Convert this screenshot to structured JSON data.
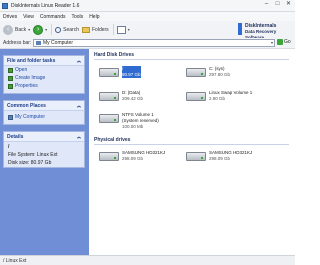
{
  "window": {
    "title": "DiskInternals Linux Reader 1.6"
  },
  "menu": [
    "Drives",
    "View",
    "Commands",
    "Tools",
    "Help"
  ],
  "toolbar": {
    "back": "Back",
    "search": "Search",
    "folders": "Folders"
  },
  "address": {
    "label": "Address bar:",
    "value": "My Computer",
    "go": "Go"
  },
  "brand": {
    "name": "DiskInternals",
    "tagline": "Data Recovery Software"
  },
  "sidebar": {
    "tasks_title": "File and folder tasks",
    "tasks": [
      "Open",
      "Create Image",
      "Properties"
    ],
    "places_title": "Common Places",
    "places": [
      "My Computer"
    ],
    "details_title": "Details",
    "details_name": "/",
    "details_fs": "File System: Linux Ext",
    "details_size": "Disk size: 80.97 Gb"
  },
  "content": {
    "hdd_title": "Hard Disk Drives",
    "drives": [
      {
        "name": "/",
        "size": "80.97 Gb",
        "selected": true
      },
      {
        "name": "C: (sys)",
        "size": "297.80 Gb",
        "selected": false
      },
      {
        "name": "D: (Data)",
        "size": "209.42 Gb",
        "selected": false
      },
      {
        "name": "Linux Swap Volume 1",
        "size": "2.90 Gb",
        "selected": false
      },
      {
        "name": "NTFS Volume 1",
        "name2": "(System reserved)",
        "size": "100.00 Mb",
        "selected": false
      }
    ],
    "phys_title": "Physical drives",
    "physical": [
      {
        "name": "SAMSUNG HD321KJ",
        "size": "298.09 Gb"
      },
      {
        "name": "SAMSUNG HD321KJ",
        "size": "298.09 Gb"
      }
    ]
  },
  "status": {
    "text": "/ Linux Ext"
  }
}
